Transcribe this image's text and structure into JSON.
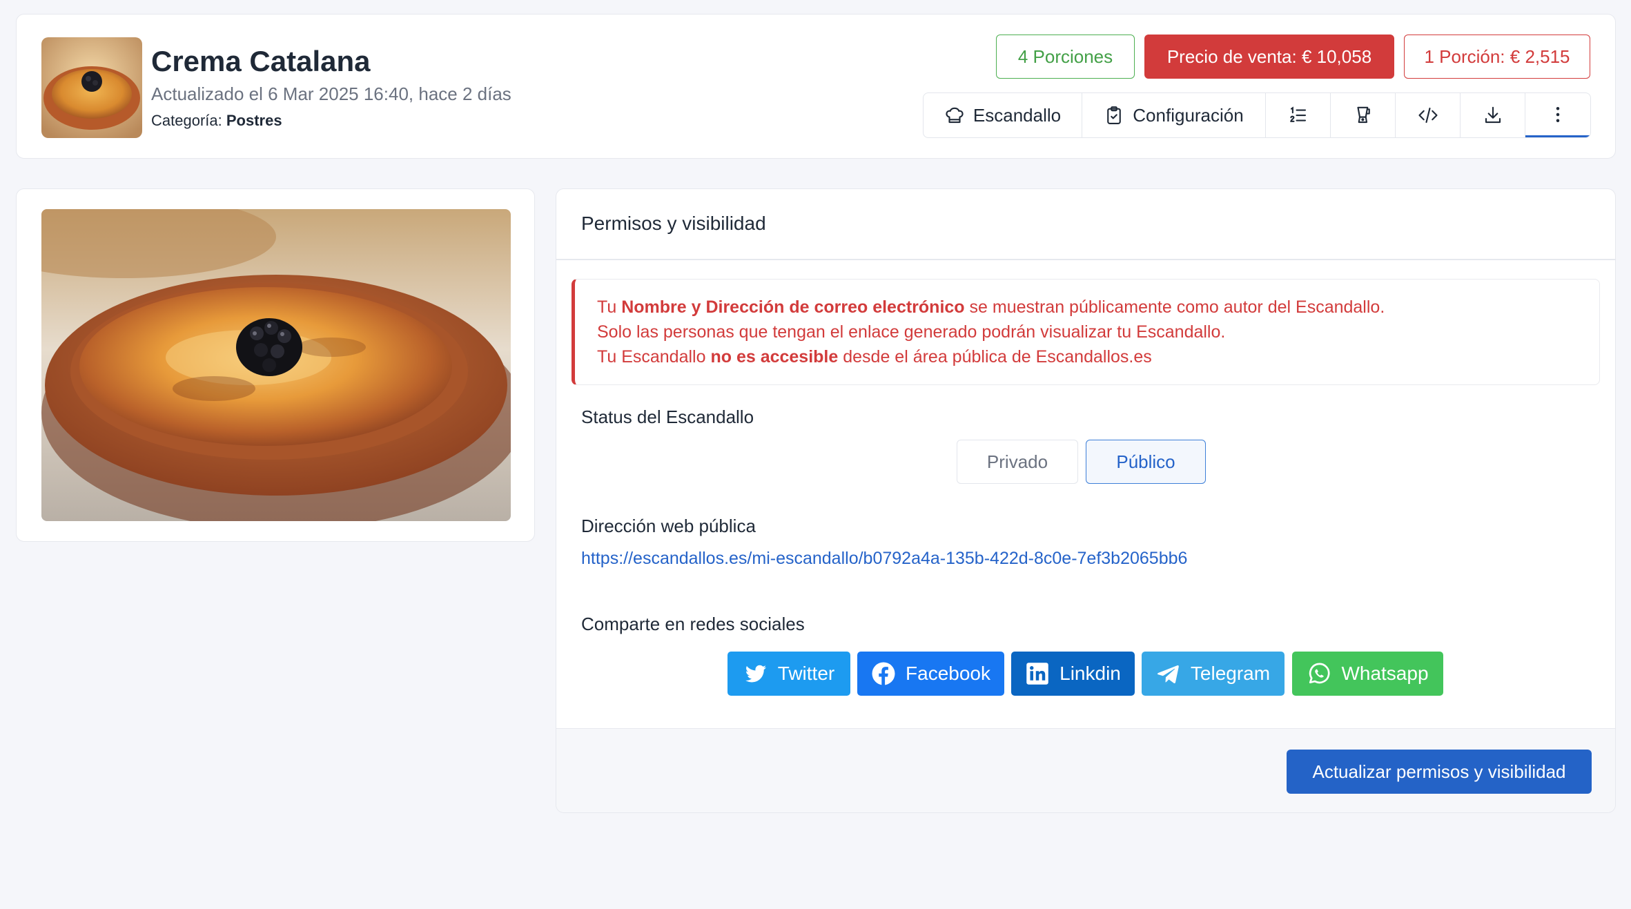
{
  "header": {
    "title": "Crema Catalana",
    "updated": "Actualizado el 6 Mar 2025 16:40, hace 2 días",
    "category_label": "Categoría:",
    "category_value": "Postres",
    "badges": {
      "portions": "4 Porciones",
      "price": "Precio de venta: € 10,058",
      "portion_price": "1 Porción: € 2,515"
    },
    "toolbar": {
      "escandallo": "Escandallo",
      "configuracion": "Configuración"
    }
  },
  "permissions": {
    "title": "Permisos y visibilidad",
    "alert": {
      "line1_pre": "Tu ",
      "line1_bold": "Nombre y Dirección de correo electrónico",
      "line1_post": " se muestran públicamente como autor del Escandallo.",
      "line2": "Solo las personas que tengan el enlace generado podrán visualizar tu Escandallo.",
      "line3_pre": "Tu Escandallo ",
      "line3_bold": "no es accesible",
      "line3_post": " desde el área pública de Escandallos.es"
    },
    "status_label": "Status del Escandallo",
    "status_options": {
      "private": "Privado",
      "public": "Público"
    },
    "status_selected": "Público",
    "web_label": "Dirección web pública",
    "web_url": "https://escandallos.es/mi-escandallo/b0792a4a-135b-422d-8c0e-7ef3b2065bb6",
    "share_label": "Comparte en redes sociales",
    "social": {
      "twitter": "Twitter",
      "facebook": "Facebook",
      "linkedin": "Linkdin",
      "telegram": "Telegram",
      "whatsapp": "Whatsapp"
    },
    "submit": "Actualizar permisos y visibilidad"
  },
  "colors": {
    "accent": "#2463c7",
    "danger": "#d23b3b",
    "success": "#43a047"
  }
}
